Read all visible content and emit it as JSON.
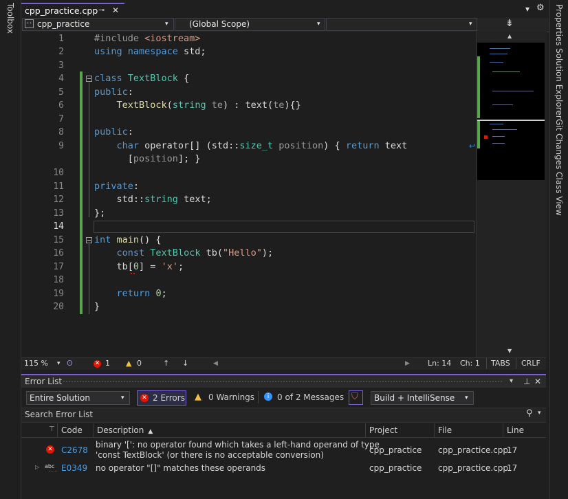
{
  "side_left": {
    "toolbox": "Toolbox"
  },
  "side_right": {
    "properties": "Properties",
    "solution_explorer": "Solution Explorer",
    "git_changes": "Git Changes",
    "class_view": "Class View"
  },
  "doc_tab": {
    "title": "cpp_practice.cpp",
    "pin": "⊸",
    "close": "✕"
  },
  "window_controls": {
    "dropdown": "▾",
    "settings": "⚙"
  },
  "nav": {
    "project": "cpp_practice",
    "scope": "(Global Scope)",
    "member": ""
  },
  "editor": {
    "line_numbers": [
      "1",
      "2",
      "3",
      "4",
      "5",
      "6",
      "7",
      "8",
      "9",
      "",
      "10",
      "11",
      "12",
      "13",
      "14",
      "15",
      "16",
      "17",
      "18",
      "19",
      "20"
    ]
  },
  "status": {
    "zoom": "115 %",
    "errors": "1",
    "warnings": "0",
    "line": "Ln: 14",
    "col": "Ch: 1",
    "tabs": "TABS",
    "eol": "CRLF"
  },
  "error_list": {
    "title": "Error List",
    "scope": "Entire Solution",
    "errors_btn": "2 Errors",
    "warnings_btn": "0 Warnings",
    "messages_btn": "0 of 2 Messages",
    "build_filter": "Build + IntelliSense",
    "search_placeholder": "Search Error List",
    "columns": {
      "code": "Code",
      "description": "Description",
      "project": "Project",
      "file": "File",
      "line": "Line"
    },
    "rows": [
      {
        "code": "C2678",
        "description_1": "binary '[': no operator found which takes a left-hand operand of type",
        "description_2": "'const TextBlock' (or there is no acceptable conversion)",
        "project": "cpp_practice",
        "file": "cpp_practice.cpp",
        "line": "17"
      },
      {
        "code": "E0349",
        "description_1": "no operator \"[]\" matches these operands",
        "project": "cpp_practice",
        "file": "cpp_practice.cpp",
        "line": "17"
      }
    ]
  },
  "colors": {
    "accent": "#7b5fd6",
    "change_bar": "#57a64a",
    "error": "#e51400",
    "link": "#4c9ee0"
  }
}
